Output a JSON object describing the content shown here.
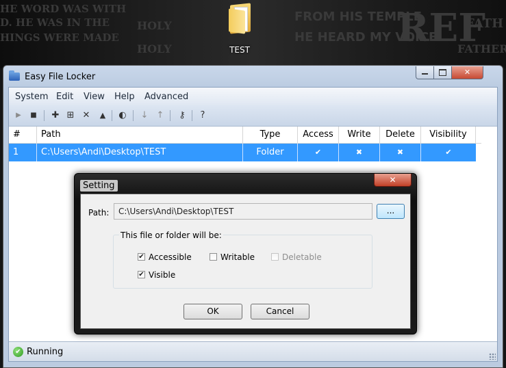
{
  "desktop": {
    "folder_label": "TEST",
    "wallpaper_text": [
      "HE WORD WAS WITH",
      "D. HE WAS IN THE",
      "HINGS WERE MADE",
      "HOLY",
      "HOLY",
      "FROM HIS TEMPLE",
      "HE HEARD MY VOICE",
      "REF",
      "FATH",
      "FATHER"
    ]
  },
  "window": {
    "title": "Easy File Locker",
    "controls": {
      "minimize": "",
      "maximize": "",
      "close": "✕"
    }
  },
  "menu": [
    "System",
    "Edit",
    "View",
    "Help",
    "Advanced"
  ],
  "toolbar": {
    "icons": [
      "play-icon",
      "stop-icon",
      "add-icon",
      "add-folder-icon",
      "delete-icon",
      "up-icon",
      "contrast-icon",
      "move-down-icon",
      "move-up-icon",
      "key-icon",
      "help-icon"
    ],
    "glyphs": [
      "▶",
      "■",
      "✚",
      "⊞",
      "✕",
      "▲",
      "◐",
      "↓",
      "↑",
      "⚷",
      "?"
    ]
  },
  "table": {
    "columns": [
      "#",
      "Path",
      "Type",
      "Access",
      "Write",
      "Delete",
      "Visibility"
    ],
    "rows": [
      {
        "num": "1",
        "path": "C:\\Users\\Andi\\Desktop\\TEST",
        "type": "Folder",
        "access": "✔",
        "write": "✖",
        "delete": "✖",
        "visibility": "✔"
      }
    ]
  },
  "status": {
    "text": "Running",
    "icon": "✔"
  },
  "dialog": {
    "title": "Setting",
    "close": "✕",
    "path_label": "Path:",
    "path_value": "C:\\Users\\Andi\\Desktop\\TEST",
    "browse_label": "...",
    "group_label": "This file or folder will be:",
    "options": {
      "accessible": {
        "label": "Accessible",
        "mark": "✔"
      },
      "writable": {
        "label": "Writable",
        "mark": ""
      },
      "deletable": {
        "label": "Deletable",
        "mark": ""
      },
      "visible": {
        "label": "Visible",
        "mark": "✔"
      }
    },
    "ok_label": "OK",
    "cancel_label": "Cancel"
  },
  "colors": {
    "selection": "#3399ff",
    "close_button": "#c74a33"
  }
}
